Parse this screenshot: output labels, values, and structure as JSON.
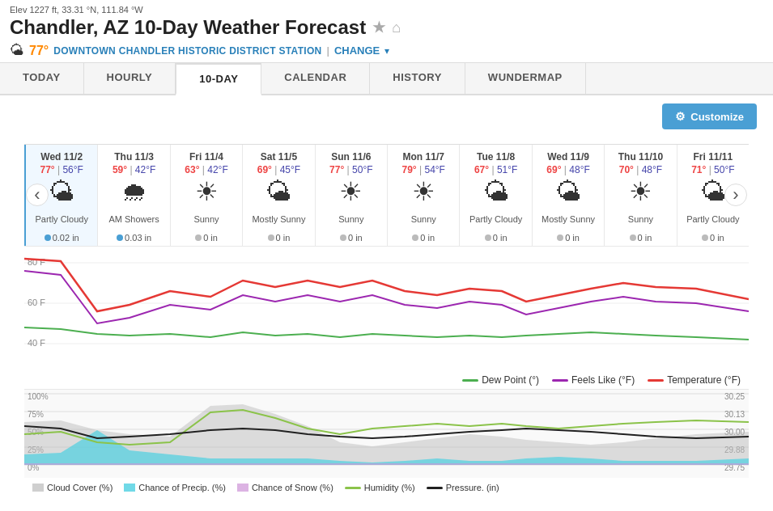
{
  "elev": "Elev 1227 ft, 33.31 °N, 111.84 °W",
  "title": "Chandler, AZ 10-Day Weather Forecast",
  "station_temp": "77°",
  "station_name": "DOWNTOWN CHANDLER HISTORIC DISTRICT STATION",
  "change_label": "CHANGE",
  "tabs": [
    {
      "id": "today",
      "label": "TODAY"
    },
    {
      "id": "hourly",
      "label": "HOURLY"
    },
    {
      "id": "10day",
      "label": "10-DAY",
      "active": true
    },
    {
      "id": "calendar",
      "label": "CALENDAR"
    },
    {
      "id": "history",
      "label": "HISTORY"
    },
    {
      "id": "wundermap",
      "label": "WUNDERMAP"
    }
  ],
  "customize_label": "Customize",
  "nav_prev": "‹",
  "nav_next": "›",
  "days": [
    {
      "date": "Wed 11/2",
      "high": "77°",
      "low": "56°F",
      "icon": "🌤",
      "desc": "Partly Cloudy",
      "precip": "0.02 in",
      "precip_type": "blue"
    },
    {
      "date": "Thu 11/3",
      "high": "59°",
      "low": "42°F",
      "icon": "🌧",
      "desc": "AM Showers",
      "precip": "0.03 in",
      "precip_type": "blue"
    },
    {
      "date": "Fri 11/4",
      "high": "63°",
      "low": "42°F",
      "icon": "☀",
      "desc": "Sunny",
      "precip": "0 in",
      "precip_type": "gray"
    },
    {
      "date": "Sat 11/5",
      "high": "69°",
      "low": "45°F",
      "icon": "🌤",
      "desc": "Mostly Sunny",
      "precip": "0 in",
      "precip_type": "gray"
    },
    {
      "date": "Sun 11/6",
      "high": "77°",
      "low": "50°F",
      "icon": "☀",
      "desc": "Sunny",
      "precip": "0 in",
      "precip_type": "gray"
    },
    {
      "date": "Mon 11/7",
      "high": "79°",
      "low": "54°F",
      "icon": "☀",
      "desc": "Sunny",
      "precip": "0 in",
      "precip_type": "gray"
    },
    {
      "date": "Tue 11/8",
      "high": "67°",
      "low": "51°F",
      "icon": "🌤",
      "desc": "Partly Cloudy",
      "precip": "0 in",
      "precip_type": "gray"
    },
    {
      "date": "Wed 11/9",
      "high": "69°",
      "low": "48°F",
      "icon": "🌤",
      "desc": "Mostly Sunny",
      "precip": "0 in",
      "precip_type": "gray"
    },
    {
      "date": "Thu 11/10",
      "high": "70°",
      "low": "48°F",
      "icon": "☀",
      "desc": "Sunny",
      "precip": "0 in",
      "precip_type": "gray"
    },
    {
      "date": "Fri 11/11",
      "high": "71°",
      "low": "50°F",
      "icon": "🌤",
      "desc": "Partly Cloudy",
      "precip": "0 in",
      "precip_type": "gray"
    }
  ],
  "legend": [
    {
      "label": "Dew Point (°)",
      "color": "#4caf50"
    },
    {
      "label": "Feels Like (°F)",
      "color": "#9c27b0"
    },
    {
      "label": "Temperature (°F)",
      "color": "#e53935"
    }
  ],
  "legend2": [
    {
      "label": "Cloud Cover (%)",
      "color": "#bbb",
      "type": "fill"
    },
    {
      "label": "Chance of Precip. (%)",
      "color": "#4dd0e1",
      "type": "fill"
    },
    {
      "label": "Chance of Snow (%)",
      "color": "#ce93d8",
      "type": "fill"
    },
    {
      "label": "Humidity (%)",
      "color": "#8bc34a",
      "type": "line"
    },
    {
      "label": "Pressure. (in)",
      "color": "#212121",
      "type": "line"
    }
  ],
  "chart_y_labels": [
    "80 F",
    "60 F",
    "40 F"
  ],
  "chart2_y_labels": [
    "100%",
    "75%",
    "50%",
    "25%",
    "0%"
  ],
  "chart2_y_right": [
    "30.25",
    "30.13",
    "30.00",
    "29.88",
    "29.75"
  ]
}
